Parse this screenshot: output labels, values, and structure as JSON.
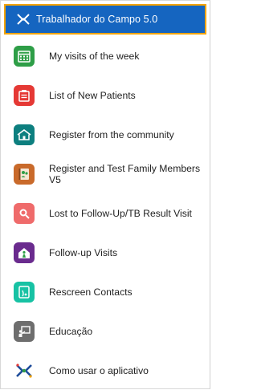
{
  "header": {
    "title": "Trabalhador do Campo 5.0"
  },
  "colors": {
    "header_bg": "#1565c0",
    "header_border": "#f4a400"
  },
  "menu": {
    "items": [
      {
        "label": "My visits of the week",
        "icon": "calendar-icon",
        "color": "#2e9e47"
      },
      {
        "label": "List of New Patients",
        "icon": "clipboard-list-icon",
        "color": "#e53935"
      },
      {
        "label": "Register from the community",
        "icon": "community-house-icon",
        "color": "#0d7f7f"
      },
      {
        "label": "Register and Test Family Members V5",
        "icon": "family-register-icon",
        "color": "#c96a2b"
      },
      {
        "label": "Lost to Follow-Up/TB Result Visit",
        "icon": "search-magnifier-icon",
        "color": "#ef6b6b"
      },
      {
        "label": "Follow-up Visits",
        "icon": "home-visit-icon",
        "color": "#6a2b8e"
      },
      {
        "label": "Rescreen Contacts",
        "icon": "rescreen-tablet-icon",
        "color": "#17c2a4"
      },
      {
        "label": "Educação",
        "icon": "education-board-icon",
        "color": "#6e6e6e"
      },
      {
        "label": "Como usar o aplicativo",
        "icon": "app-guide-icon",
        "color": "#1e4c9a"
      }
    ]
  }
}
